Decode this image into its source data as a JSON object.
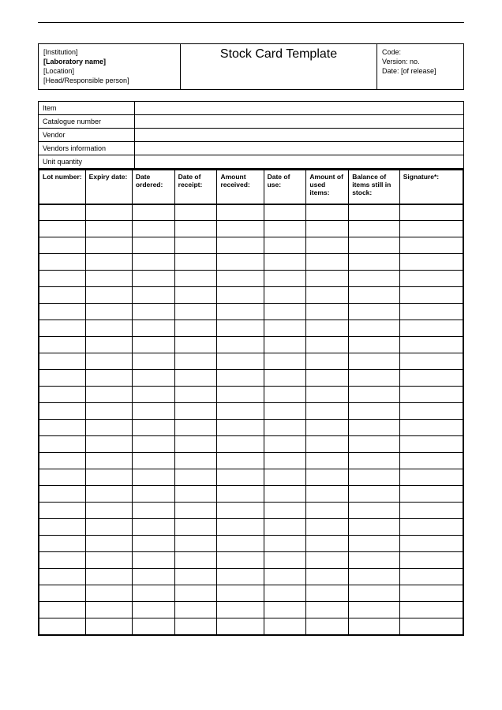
{
  "header": {
    "institution": "[Institution]",
    "laboratory": "[Laboratory name]",
    "location": "[Location]",
    "responsible": "[Head/Responsible person]",
    "title": "Stock Card Template",
    "code_label": "Code:",
    "version_label": "Version: no.",
    "date_label": "Date: [of release]"
  },
  "info": {
    "item_label": "Item",
    "catalogue_label": "Catalogue number",
    "vendor_label": "Vendor",
    "vendors_info_label": "Vendors information",
    "unit_quantity_label": "Unit quantity"
  },
  "columns": {
    "lot_number": "Lot number:",
    "expiry_date": "Expiry date:",
    "date_ordered": "Date ordered:",
    "date_receipt": "Date of receipt:",
    "amount_received": "Amount received:",
    "date_use": "Date of use:",
    "amount_used": "Amount of used items:",
    "balance": "Balance of items still in stock:",
    "signature": "Signature*:"
  },
  "row_count": 26
}
